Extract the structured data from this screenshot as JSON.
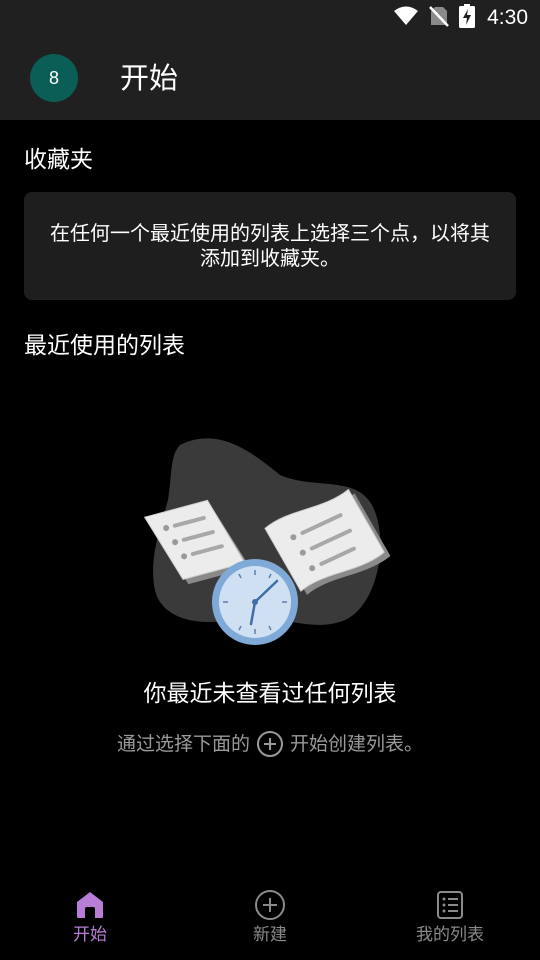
{
  "status_bar": {
    "time": "4:30",
    "icons": [
      "wifi-icon",
      "no-sim-icon",
      "battery-charging-icon"
    ]
  },
  "header": {
    "avatar_text": "8",
    "avatar_color": "#0b5e55",
    "title": "开始"
  },
  "favorites": {
    "title": "收藏夹",
    "message": "在任何一个最近使用的列表上选择三个点，以将其添加到收藏夹。"
  },
  "recent": {
    "title": "最近使用的列表",
    "empty_title": "你最近未查看过任何列表",
    "empty_hint_before": "通过选择下面的",
    "empty_hint_icon": "add-circle-icon",
    "empty_hint_after": "开始创建列表。"
  },
  "bottom_nav": {
    "items": [
      {
        "label": "开始",
        "icon": "home-icon",
        "active": true
      },
      {
        "label": "新建",
        "icon": "add-circle-icon",
        "active": false
      },
      {
        "label": "我的列表",
        "icon": "list-icon",
        "active": false
      }
    ]
  },
  "colors": {
    "accent": "#b87dd6",
    "header_bg": "#202020",
    "card_bg": "#1e1e1e",
    "background": "#000000"
  }
}
